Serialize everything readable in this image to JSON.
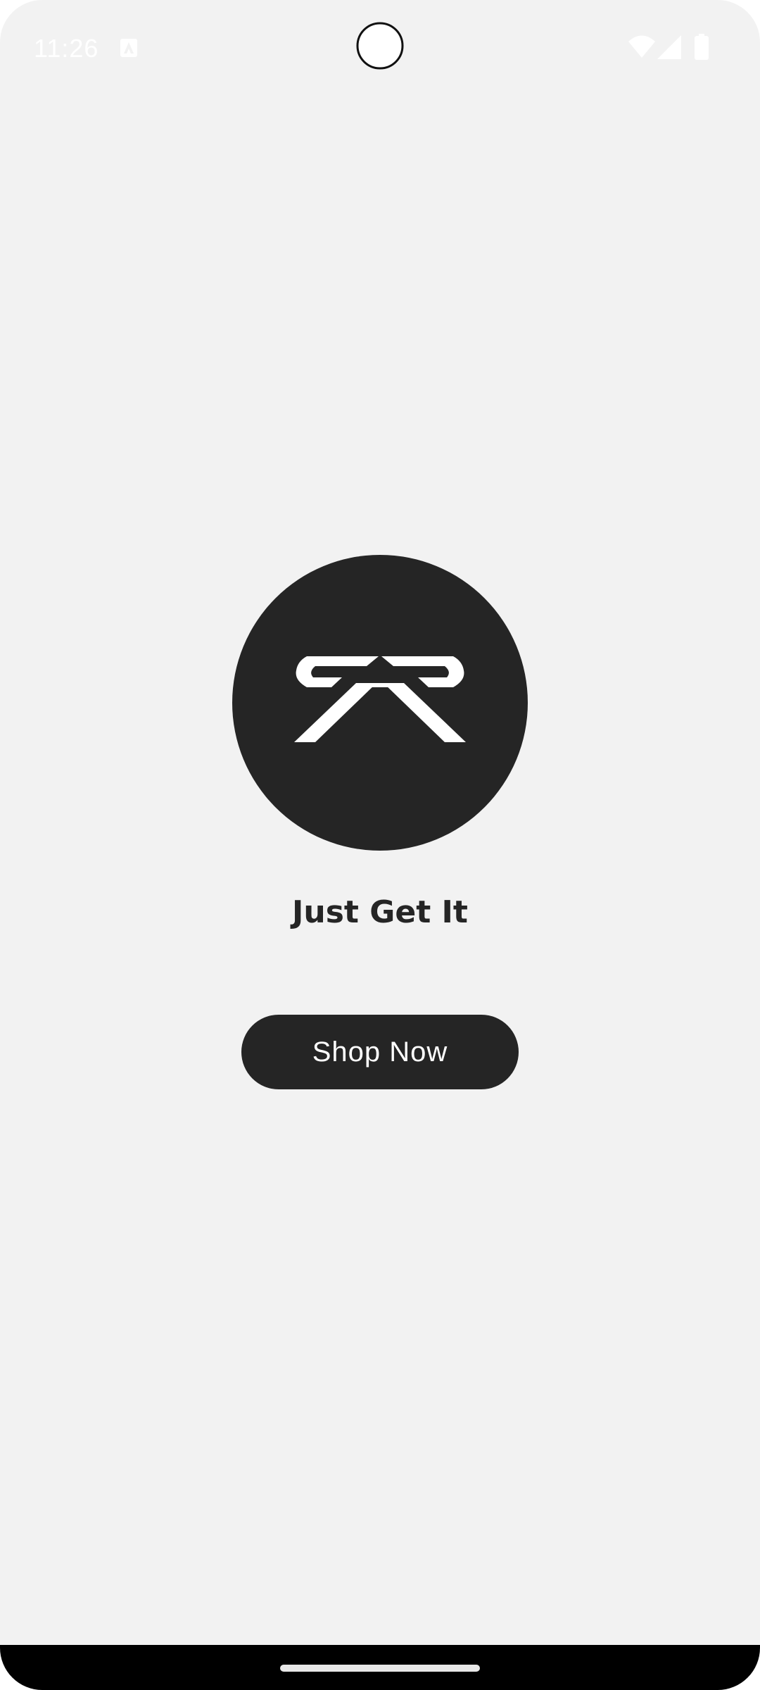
{
  "status_bar": {
    "time": "11:26",
    "icons": [
      "notification-app-icon",
      "wifi-icon",
      "signal-icon",
      "battery-icon"
    ]
  },
  "main": {
    "logo": {
      "icon": "brand-logo-icon"
    },
    "tagline": "Just Get It",
    "shop_button_label": "Shop Now"
  },
  "colors": {
    "background": "#f2f2f2",
    "primary": "#252525",
    "on_primary": "#ffffff",
    "nav_bar": "#000000"
  }
}
